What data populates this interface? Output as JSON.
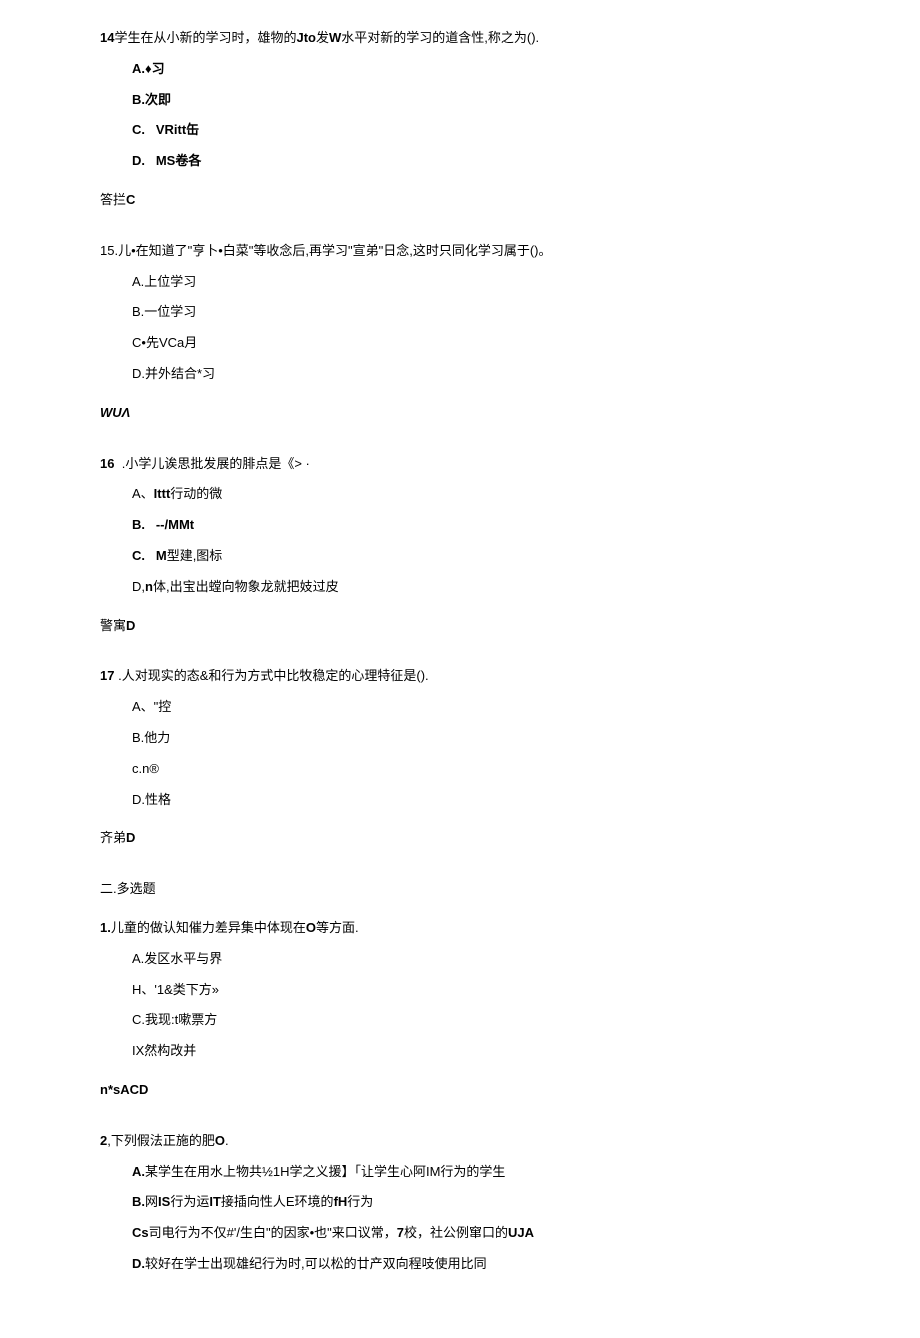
{
  "q14": {
    "stem_a": "14",
    "stem_b": "学生在从小新的学习时，雄物的",
    "stem_c": "Jto",
    "stem_d": "发",
    "stem_e": "W",
    "stem_f": "水平对新的学习的道含性,称之为().",
    "optA": "A.♦习",
    "optB": "B.次即",
    "optC_a": "C.",
    "optC_b": "VRitt缶",
    "optD_a": "D.",
    "optD_b": "MS卷各",
    "ans_a": "答拦",
    "ans_b": "C"
  },
  "q15": {
    "stem": "15.儿•在知道了\"亨卜•白菜\"等收念后,再学习\"宣弟\"日念,这时只同化学习属于()。",
    "optA": "A.上位学习",
    "optB": "B.一位学习",
    "optC": "C•先VCa月",
    "optD": "D.并外结合*习",
    "ans": "WUΛ"
  },
  "q16": {
    "stem_a": "16",
    "stem_b": ".小学儿诶思批发展的腓点是《> ·",
    "optA_a": "A、",
    "optA_b": "Ittt",
    "optA_c": "行动的微",
    "optB_a": "B.",
    "optB_b": "--/MMt",
    "optC_a": "C.",
    "optC_b": "M",
    "optC_c": "型建,图标",
    "optD_a": "D,",
    "optD_b": "n",
    "optD_c": "体,出宝出螳向物象龙就把妓过皮",
    "ans_a": "警寓",
    "ans_b": "D"
  },
  "q17": {
    "stem_a": "17",
    "stem_b": " .人对现实的态&和行为方式中比牧稳定的心理特征是().",
    "optA": "A、\"控",
    "optB": "B.他力",
    "optC": "c.n®",
    "optD": "D.性格",
    "ans_a": "齐弟",
    "ans_b": "D"
  },
  "section2": {
    "title": "二.多选题"
  },
  "m1": {
    "stem_a": "1.",
    "stem_b": "儿童的做认知催力差异集中体现在",
    "stem_c": "O",
    "stem_d": "等方面.",
    "optA": "A.发区水平与界",
    "optB": "H、'1&类下方»",
    "optC": "C.我现:t嗽票方",
    "optD": "IX然构改并",
    "ans_a": "n*s",
    "ans_b": "ACD"
  },
  "m2": {
    "stem_a": "2",
    "stem_b": ",下列假法正施的肥",
    "stem_c": "O",
    "stem_d": ".",
    "optA_a": "A.",
    "optA_b": "某学生在用水上物共½1H学之义援】「让学生心阿IM行为的学生",
    "optB_a": "B.",
    "optB_b": "网",
    "optB_c": "IS",
    "optB_d": "行为运",
    "optB_e": "IT",
    "optB_f": "接插向性人E环境的",
    "optB_g": "fH",
    "optB_h": "行为",
    "optC_a": "Cs",
    "optC_b": "司电行为不仅#'/生白\"的因家•也\"来口议常，",
    "optC_c": "7",
    "optC_d": "校，社公例窜口的",
    "optC_e": "UJA",
    "optD_a": "D.",
    "optD_b": "较好在学士出现雄纪行为时,可以松的廿产双向程吱使用比同"
  }
}
